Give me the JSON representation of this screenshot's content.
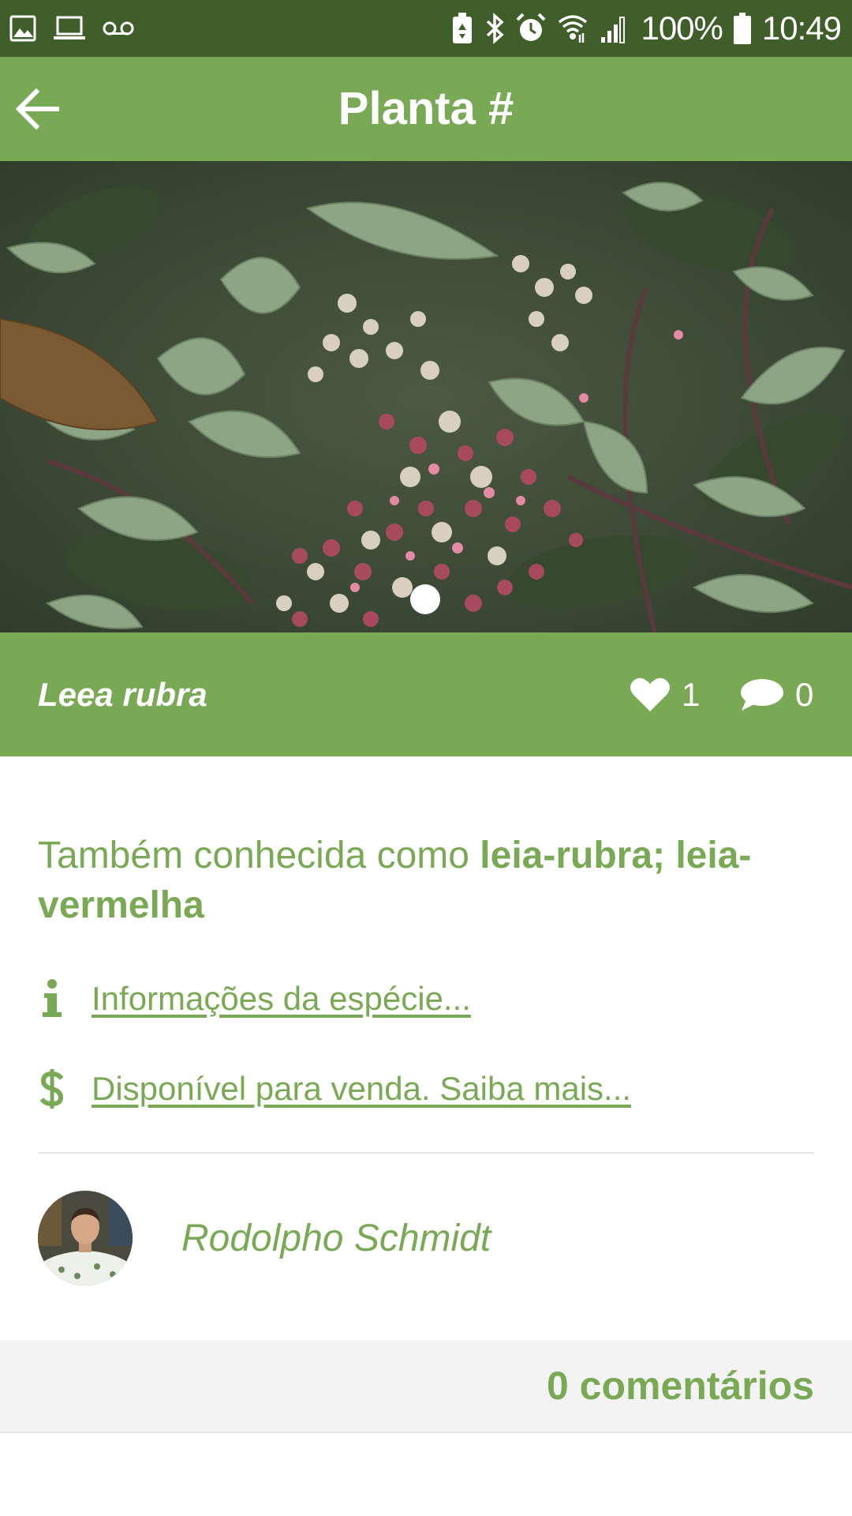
{
  "status_bar": {
    "icons_left": [
      "image-icon",
      "laptop-icon",
      "voicemail-icon"
    ],
    "icons_right": [
      "battery-saver-icon",
      "bluetooth-icon",
      "alarm-icon",
      "wifi-icon",
      "signal-icon"
    ],
    "battery": "100%",
    "time": "10:49"
  },
  "app_bar": {
    "title": "Planta #",
    "back_icon": "arrow-left-icon"
  },
  "photo": {
    "pager_dots": 1,
    "active_dot": 0
  },
  "plant": {
    "scientific_name": "Leea rubra",
    "likes": "1",
    "comments": "0",
    "like_icon": "heart-icon",
    "comment_icon": "speech-bubble-icon"
  },
  "info": {
    "aka_prefix": "Também conhecida como ",
    "aka_names": "leia-rubra; leia-vermelha",
    "species_info_link": "Informações da espécie...",
    "sale_link": "Disponível para venda. Saiba mais...",
    "info_icon": "info-icon",
    "dollar_icon": "dollar-icon"
  },
  "author": {
    "name": "Rodolpho Schmidt"
  },
  "comments_section": {
    "label": "0 comentários"
  },
  "colors": {
    "primary": "#79a955",
    "status_bar": "#3f5e2a",
    "comments_bg": "#f3f3f3"
  }
}
